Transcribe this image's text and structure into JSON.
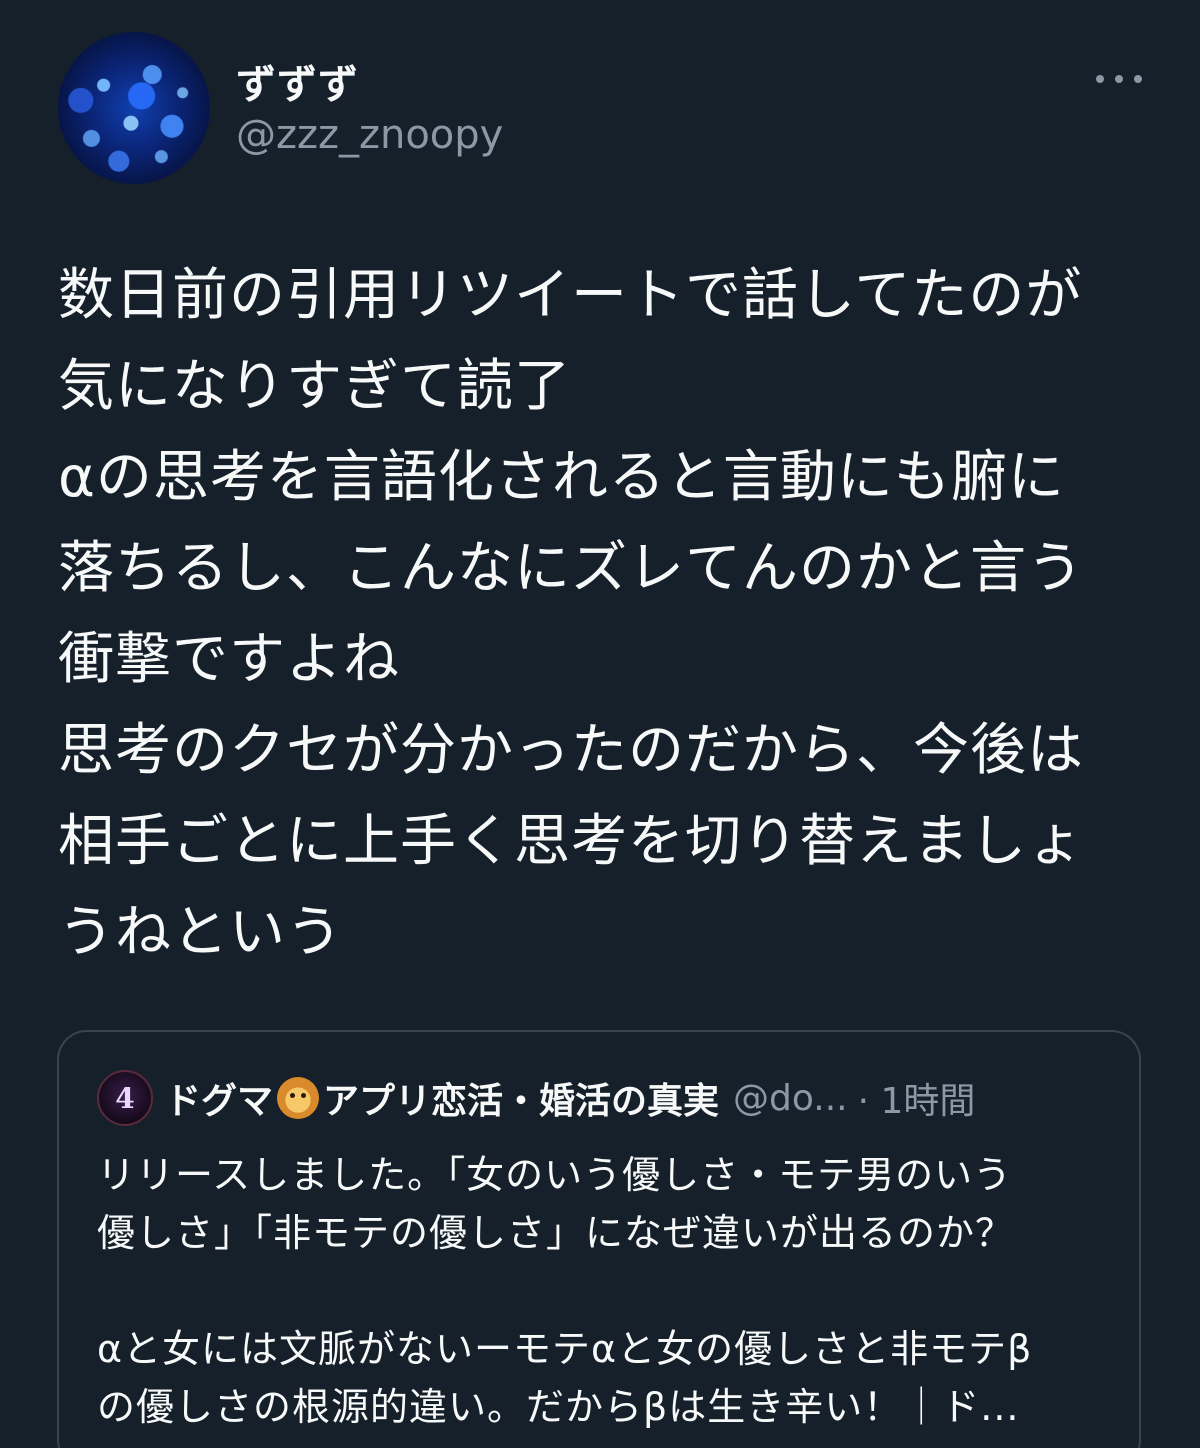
{
  "tweet": {
    "display_name": "ずずず",
    "handle": "@zzz_znoopy",
    "more_icon": "more-horizontal-icon",
    "text": "数日前の引用リツイートで話してたのが\n気になりすぎて読了\nαの思考を言語化されると言動にも腑に\n落ちるし、こんなにズレてんのかと言う\n衝撃ですよね\n思考のクセが分かったのだから、今後は\n相手ごとに上手く思考を切り替えましょ\nうねという"
  },
  "quote": {
    "avatar_glyph": "4",
    "name_part1": "ドグマ",
    "emoji_icon": "lion-face-icon",
    "name_part2": "アプリ恋活・婚活の真実",
    "handle": "@do...",
    "time": "· 1時間",
    "text": "リリースしました。「女のいう優しさ・モテ男のいう\n優しさ」「非モテの優しさ」になぜ違いが出るのか？\n\nαと女には文脈がないーモテαと女の優しさと非モテβ\nの優しさの根源的違い。だからβは生き辛い！｜ド..."
  },
  "colors": {
    "background": "#15202b",
    "text": "#f7f9f9",
    "secondary_text": "#8b98a5",
    "border": "#38444d"
  }
}
